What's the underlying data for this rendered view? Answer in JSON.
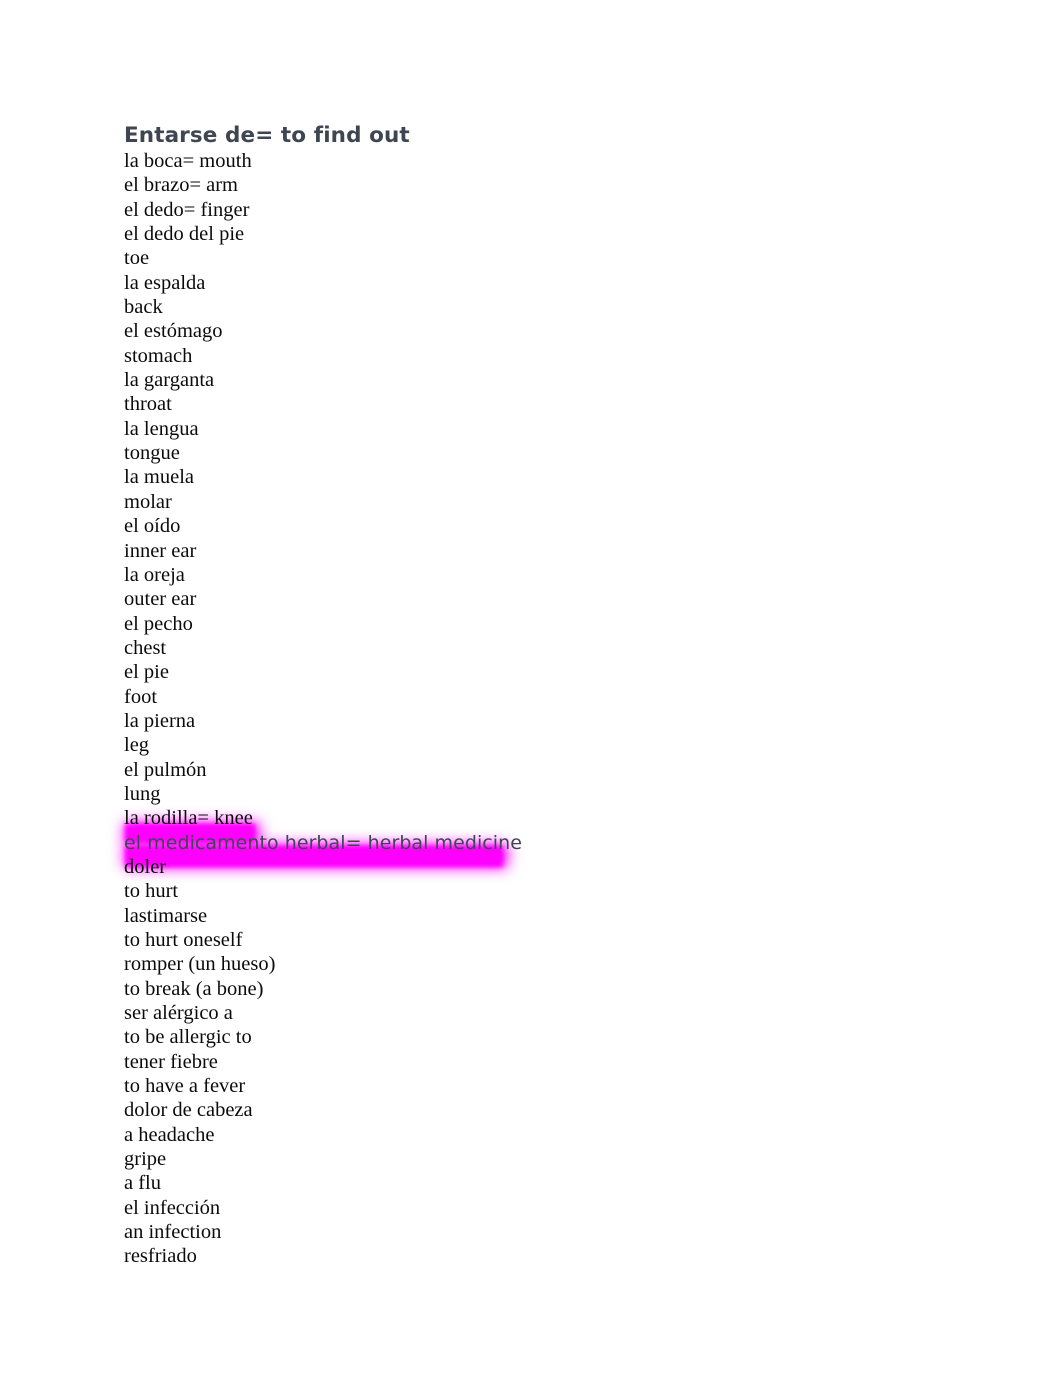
{
  "document": {
    "title": "Entarse de= to find out",
    "highlight_color": "#ff00ff",
    "title_color": "#3e4651",
    "body_color": "#0b0b0b",
    "lines": [
      {
        "text": "la boca= mouth",
        "style": "serif",
        "highlighted": false
      },
      {
        "text": "el brazo= arm",
        "style": "serif",
        "highlighted": false
      },
      {
        "text": "el dedo= finger",
        "style": "serif",
        "highlighted": false
      },
      {
        "text": "el dedo del pie",
        "style": "serif",
        "highlighted": false
      },
      {
        "text": "toe",
        "style": "serif",
        "highlighted": false
      },
      {
        "text": "la espalda",
        "style": "serif",
        "highlighted": false
      },
      {
        "text": "back",
        "style": "serif",
        "highlighted": false
      },
      {
        "text": "el estómago",
        "style": "serif",
        "highlighted": false
      },
      {
        "text": "stomach",
        "style": "serif",
        "highlighted": false
      },
      {
        "text": "la garganta",
        "style": "serif",
        "highlighted": false
      },
      {
        "text": "throat",
        "style": "serif",
        "highlighted": false
      },
      {
        "text": "la lengua",
        "style": "serif",
        "highlighted": false
      },
      {
        "text": "tongue",
        "style": "serif",
        "highlighted": false
      },
      {
        "text": "la muela",
        "style": "serif",
        "highlighted": false
      },
      {
        "text": "molar",
        "style": "serif",
        "highlighted": false
      },
      {
        "text": "el oído",
        "style": "serif",
        "highlighted": false
      },
      {
        "text": "inner ear",
        "style": "serif",
        "highlighted": false
      },
      {
        "text": "la oreja",
        "style": "serif",
        "highlighted": false
      },
      {
        "text": "outer ear",
        "style": "serif",
        "highlighted": false
      },
      {
        "text": "el pecho",
        "style": "serif",
        "highlighted": false
      },
      {
        "text": "chest",
        "style": "serif",
        "highlighted": false
      },
      {
        "text": "el pie",
        "style": "serif",
        "highlighted": false
      },
      {
        "text": "foot",
        "style": "serif",
        "highlighted": false
      },
      {
        "text": "la pierna",
        "style": "serif",
        "highlighted": false
      },
      {
        "text": "leg",
        "style": "serif",
        "highlighted": false
      },
      {
        "text": "el pulmón",
        "style": "serif",
        "highlighted": false
      },
      {
        "text": "lung",
        "style": "serif",
        "highlighted": false
      },
      {
        "text": "la rodilla= knee",
        "style": "serif",
        "highlighted": true
      },
      {
        "text": "el medicamento herbal= herbal medicine",
        "style": "sans",
        "highlighted": true
      },
      {
        "text": "doler",
        "style": "serif",
        "highlighted": false
      },
      {
        "text": "to hurt",
        "style": "serif",
        "highlighted": false
      },
      {
        "text": "lastimarse",
        "style": "serif",
        "highlighted": false
      },
      {
        "text": "to hurt oneself",
        "style": "serif",
        "highlighted": false
      },
      {
        "text": "romper (un hueso)",
        "style": "serif",
        "highlighted": false
      },
      {
        "text": "to break (a bone)",
        "style": "serif",
        "highlighted": false
      },
      {
        "text": "ser alérgico a",
        "style": "serif",
        "highlighted": false
      },
      {
        "text": "to be allergic to",
        "style": "serif",
        "highlighted": false
      },
      {
        "text": "tener fiebre",
        "style": "serif",
        "highlighted": false
      },
      {
        "text": "to have a fever",
        "style": "serif",
        "highlighted": false
      },
      {
        "text": "dolor de cabeza",
        "style": "serif",
        "highlighted": false
      },
      {
        "text": "a headache",
        "style": "serif",
        "highlighted": false
      },
      {
        "text": "gripe",
        "style": "serif",
        "highlighted": false
      },
      {
        "text": "a flu",
        "style": "serif",
        "highlighted": false
      },
      {
        "text": "el infección",
        "style": "serif",
        "highlighted": false
      },
      {
        "text": "an infection",
        "style": "serif",
        "highlighted": false
      },
      {
        "text": "resfriado",
        "style": "serif",
        "highlighted": false
      }
    ]
  }
}
